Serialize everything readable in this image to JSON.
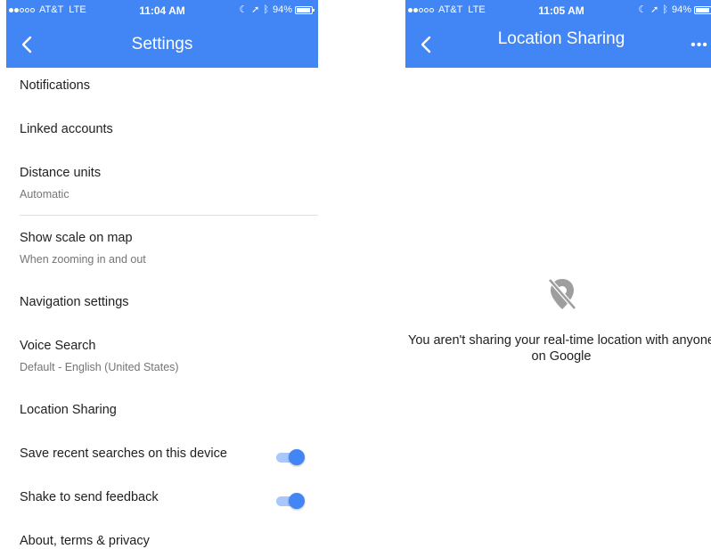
{
  "left_screen": {
    "status_bar": {
      "carrier": "AT&T",
      "network": "LTE",
      "time": "11:04 AM",
      "battery": "94%",
      "battery_level": 0.94,
      "signal_bars_filled": 2,
      "signal_bars_total": 5
    },
    "title": "Settings",
    "settings": [
      {
        "label": "Notifications"
      },
      {
        "label": "Linked accounts"
      },
      {
        "label": "Distance units",
        "sub": "Automatic"
      },
      {
        "label": "Show scale on map",
        "sub": "When zooming in and out"
      },
      {
        "label": "Navigation settings"
      },
      {
        "label": "Voice Search",
        "sub": "Default - English (United States)"
      },
      {
        "label": "Location Sharing"
      },
      {
        "label": "Save recent searches on this device",
        "toggle": true
      },
      {
        "label": "Shake to send feedback",
        "toggle": true
      },
      {
        "label": "About, terms & privacy"
      }
    ]
  },
  "right_screen": {
    "status_bar": {
      "carrier": "AT&T",
      "network": "LTE",
      "time": "11:05 AM",
      "battery": "94%",
      "battery_level": 0.94,
      "signal_bars_filled": 2,
      "signal_bars_total": 5
    },
    "title": "Location Sharing",
    "empty_message": "You aren't sharing your real-time location with anyone on Google",
    "empty_icon": "location-off-icon"
  },
  "colors": {
    "appbar": "#4285f4",
    "toggle_on": "#4285f4",
    "toggle_track": "#a8c7fa",
    "secondary_text": "#757575"
  }
}
